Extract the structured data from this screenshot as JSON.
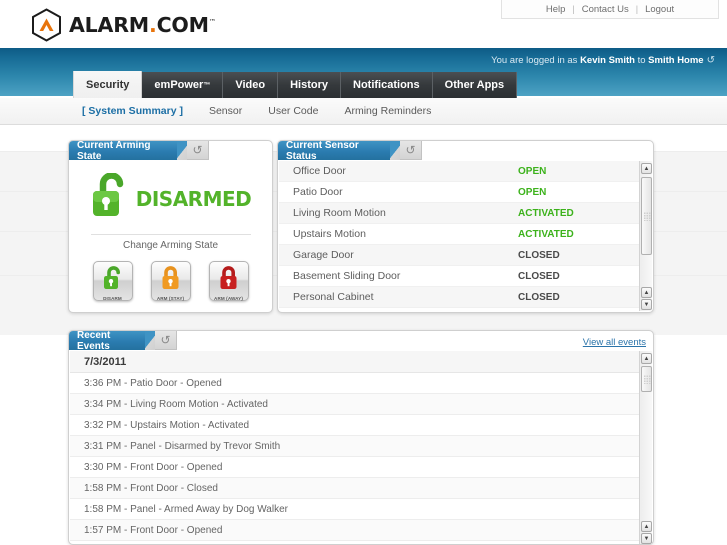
{
  "brand": {
    "logo_word": "ALARM",
    "logo_dot": ".",
    "logo_word2": "COM",
    "logo_tm": "™",
    "logo_icon": "alarm-hexagon-logo"
  },
  "utility_links": [
    {
      "label": "Help"
    },
    {
      "label": "Contact Us"
    },
    {
      "label": "Logout"
    }
  ],
  "separator": "|",
  "login_status": {
    "prefix": "You are logged in as ",
    "user": "Kevin Smith",
    "middle": " to ",
    "account": "Smith Home",
    "refresh_icon": "↺"
  },
  "tabs": [
    {
      "label": "Security",
      "active": true
    },
    {
      "label": "emPower",
      "tm": "™",
      "active": false
    },
    {
      "label": "Video",
      "active": false
    },
    {
      "label": "History",
      "active": false
    },
    {
      "label": "Notifications",
      "active": false
    },
    {
      "label": "Other Apps",
      "active": false
    }
  ],
  "subnav": [
    {
      "label": "[ System Summary ]",
      "current": true
    },
    {
      "label": "Sensor",
      "current": false
    },
    {
      "label": "User Code",
      "current": false
    },
    {
      "label": "Arming Reminders",
      "current": false
    }
  ],
  "arming_panel": {
    "title": "Current Arming State",
    "refresh_icon": "↺",
    "state": "DISARMED",
    "state_color": "#53b32a",
    "change_label": "Change Arming State",
    "buttons": [
      {
        "label": "DISARM",
        "color": "#4aa72a",
        "locked": false,
        "icon": "unlocked-padlock-icon"
      },
      {
        "label": "ARM (STAY)",
        "color": "#e8921e",
        "locked": true,
        "icon": "locked-padlock-icon"
      },
      {
        "label": "ARM (AWAY)",
        "color": "#c01f1f",
        "locked": true,
        "icon": "locked-padlock-icon"
      }
    ]
  },
  "sensor_panel": {
    "title": "Current Sensor Status",
    "refresh_icon": "↺",
    "rows": [
      {
        "name": "Office Door",
        "status": "OPEN",
        "active": true
      },
      {
        "name": "Patio Door",
        "status": "OPEN",
        "active": true
      },
      {
        "name": "Living Room Motion",
        "status": "ACTIVATED",
        "active": true
      },
      {
        "name": "Upstairs Motion",
        "status": "ACTIVATED",
        "active": true
      },
      {
        "name": "Garage Door",
        "status": "CLOSED",
        "active": false
      },
      {
        "name": "Basement Sliding Door",
        "status": "CLOSED",
        "active": false
      },
      {
        "name": "Personal Cabinet",
        "status": "CLOSED",
        "active": false
      }
    ]
  },
  "events_panel": {
    "title": "Recent Events",
    "refresh_icon": "↺",
    "view_all": "View all events",
    "date": "7/3/2011",
    "rows": [
      {
        "text": "3:36 PM - Patio Door - Opened"
      },
      {
        "text": "3:34 PM - Living Room Motion - Activated"
      },
      {
        "text": "3:32 PM - Upstairs Motion - Activated"
      },
      {
        "text": "3:31 PM - Panel - Disarmed by Trevor Smith"
      },
      {
        "text": "3:30 PM - Front Door - Opened"
      },
      {
        "text": "1:58 PM - Front Door - Closed"
      },
      {
        "text": "1:58 PM - Panel - Armed Away by Dog Walker"
      },
      {
        "text": "1:57 PM - Front Door - Opened"
      }
    ]
  },
  "scrollbar": {
    "up_arrow": "▲",
    "down_arrow": "▼"
  },
  "colors": {
    "brand_orange": "#e8740c",
    "banner_blue": "#2b7cb0",
    "status_green": "#3cb21b",
    "link_blue": "#2b74aa"
  }
}
